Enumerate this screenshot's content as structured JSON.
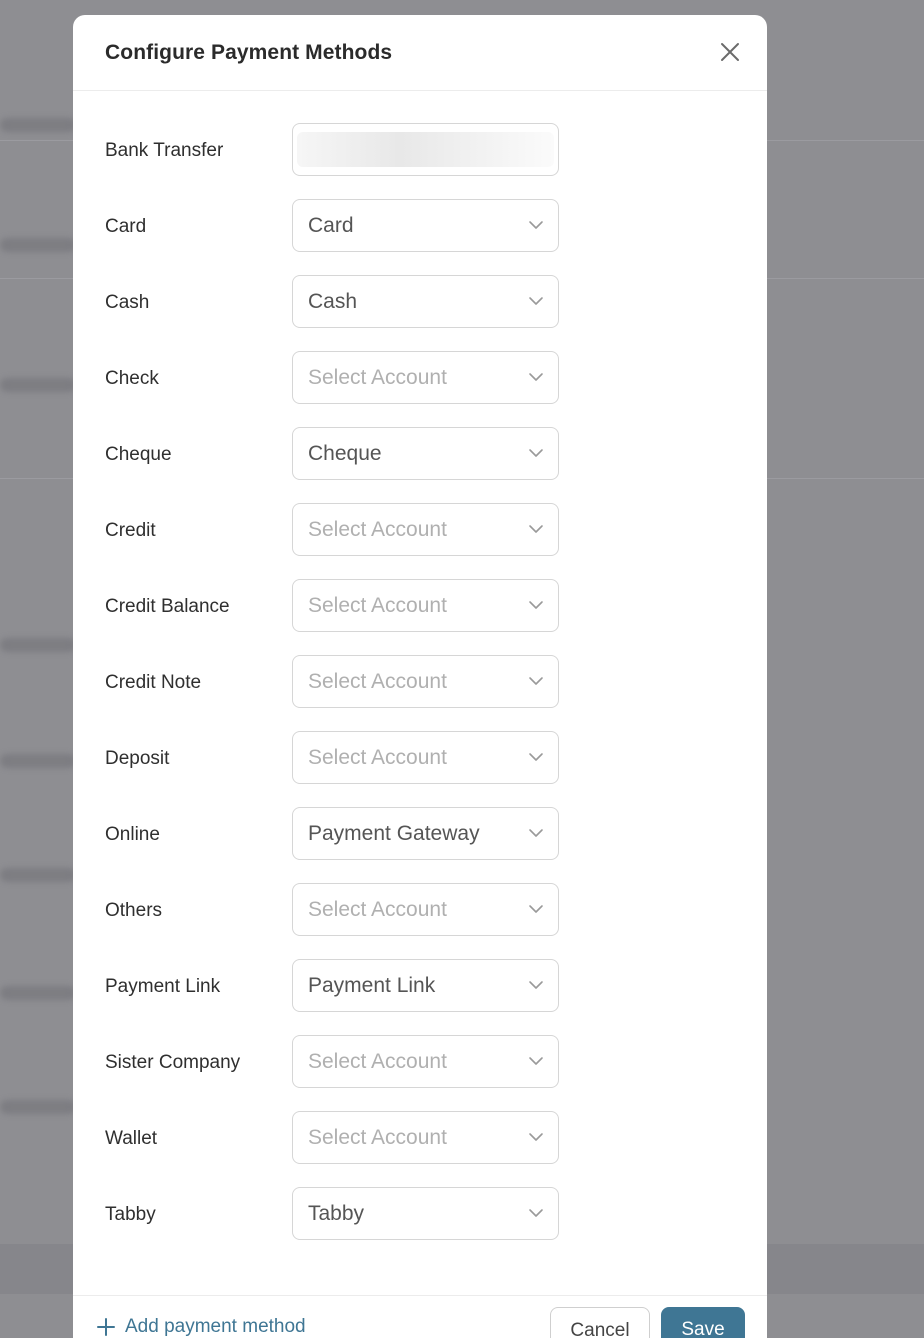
{
  "modal": {
    "title": "Configure Payment Methods"
  },
  "placeholder": "Select Account",
  "rows": [
    {
      "label": "Bank Transfer",
      "value": null,
      "loading": true
    },
    {
      "label": "Card",
      "value": "Card"
    },
    {
      "label": "Cash",
      "value": "Cash"
    },
    {
      "label": "Check",
      "value": null
    },
    {
      "label": "Cheque",
      "value": "Cheque"
    },
    {
      "label": "Credit",
      "value": null
    },
    {
      "label": "Credit Balance",
      "value": null
    },
    {
      "label": "Credit Note",
      "value": null
    },
    {
      "label": "Deposit",
      "value": null
    },
    {
      "label": "Online",
      "value": "Payment Gateway"
    },
    {
      "label": "Others",
      "value": null
    },
    {
      "label": "Payment Link",
      "value": "Payment Link"
    },
    {
      "label": "Sister Company",
      "value": null
    },
    {
      "label": "Wallet",
      "value": null
    },
    {
      "label": "Tabby",
      "value": "Tabby"
    }
  ],
  "footer": {
    "add_label": "Add payment method",
    "cancel_label": "Cancel",
    "save_label": "Save"
  },
  "colors": {
    "accent": "#3f7694",
    "overlay": "#8f8f93"
  },
  "icons": {
    "close": "close-icon",
    "chevron": "chevron-down-icon",
    "plus": "plus-icon"
  }
}
